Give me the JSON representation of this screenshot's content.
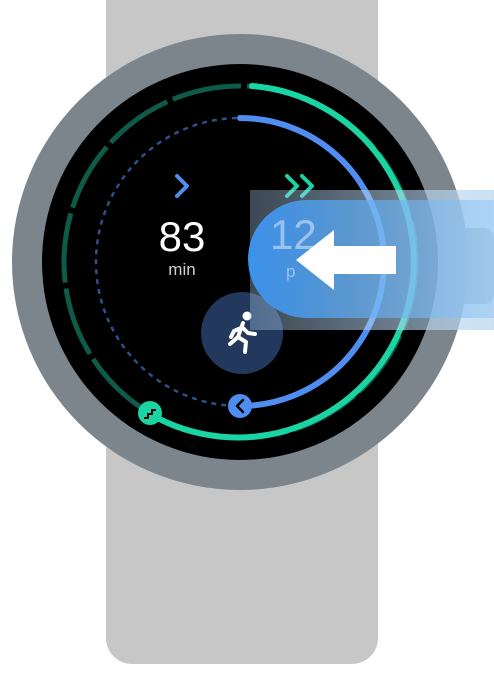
{
  "watch_face": {
    "left_metric": {
      "value": "83",
      "unit": "min"
    },
    "right_metric": {
      "value": "12",
      "unit": "p"
    }
  },
  "icons": {
    "left_chevron": "chevron-right-icon",
    "right_chevron": "double-chevron-right-icon",
    "activity": "running-person-icon",
    "ring_start_left": "stairs-icon",
    "ring_start_right": "chevron-left-icon",
    "swipe": "arrow-left-icon"
  },
  "colors": {
    "ring_green": "#1bd4a3",
    "ring_blue": "#4f8ef0",
    "activity_bg": "#22385c",
    "case": "#7c858c",
    "band": "#c7c7c7"
  }
}
